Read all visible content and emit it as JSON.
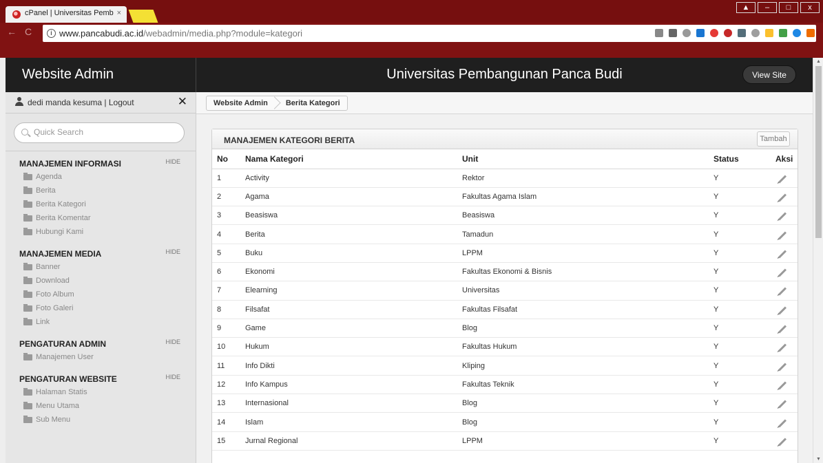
{
  "browser": {
    "tab_title": "cPanel | Universitas Pemb",
    "tab_close": "×",
    "window_controls": [
      "▲",
      "–",
      "□",
      "x"
    ],
    "url_host": "www.pancabudi.ac.id",
    "url_path": "/webadmin/media.php?module=kategori"
  },
  "header": {
    "site_title": "Website Admin",
    "university": "Universitas Pembangunan Panca Budi",
    "view_site": "View Site"
  },
  "sidebar": {
    "user": "dedi manda kesuma | Logout",
    "close": "✕",
    "search_placeholder": "Quick Search",
    "groups": [
      {
        "title": "MANAJEMEN INFORMASI",
        "hide": "HIDE",
        "items": [
          "Agenda",
          "Berita",
          "Berita Kategori",
          "Berita Komentar",
          "Hubungi Kami"
        ]
      },
      {
        "title": "MANAJEMEN MEDIA",
        "hide": "HIDE",
        "items": [
          "Banner",
          "Download",
          "Foto Album",
          "Foto Galeri",
          "Link"
        ]
      },
      {
        "title": "PENGATURAN ADMIN",
        "hide": "HIDE",
        "items": [
          "Manajemen User"
        ]
      },
      {
        "title": "PENGATURAN WEBSITE",
        "hide": "HIDE",
        "items": [
          "Halaman Statis",
          "Menu Utama",
          "Sub Menu"
        ]
      }
    ]
  },
  "breadcrumb": [
    "Website Admin",
    "Berita Kategori"
  ],
  "panel": {
    "title": "MANAJEMEN KATEGORI BERITA",
    "add_button": "Tambah",
    "columns": [
      "No",
      "Nama Kategori",
      "Unit",
      "Status",
      "Aksi"
    ],
    "rows": [
      [
        "1",
        "Activity",
        "Rektor",
        "Y"
      ],
      [
        "2",
        "Agama",
        "Fakultas Agama Islam",
        "Y"
      ],
      [
        "3",
        "Beasiswa",
        "Beasiswa",
        "Y"
      ],
      [
        "4",
        "Berita",
        "Tamadun",
        "Y"
      ],
      [
        "5",
        "Buku",
        "LPPM",
        "Y"
      ],
      [
        "6",
        "Ekonomi",
        "Fakultas Ekonomi & Bisnis",
        "Y"
      ],
      [
        "7",
        "Elearning",
        "Universitas",
        "Y"
      ],
      [
        "8",
        "Filsafat",
        "Fakultas Filsafat",
        "Y"
      ],
      [
        "9",
        "Game",
        "Blog",
        "Y"
      ],
      [
        "10",
        "Hukum",
        "Fakultas Hukum",
        "Y"
      ],
      [
        "11",
        "Info Dikti",
        "Kliping",
        "Y"
      ],
      [
        "12",
        "Info Kampus",
        "Fakultas Teknik",
        "Y"
      ],
      [
        "13",
        "Internasional",
        "Blog",
        "Y"
      ],
      [
        "14",
        "Islam",
        "Blog",
        "Y"
      ],
      [
        "15",
        "Jurnal Regional",
        "LPPM",
        "Y"
      ]
    ]
  },
  "colors": {
    "browser_frame": "#760f0f",
    "admin_header": "#1f1f1f",
    "sidebar_bg": "#e6e6e6"
  }
}
